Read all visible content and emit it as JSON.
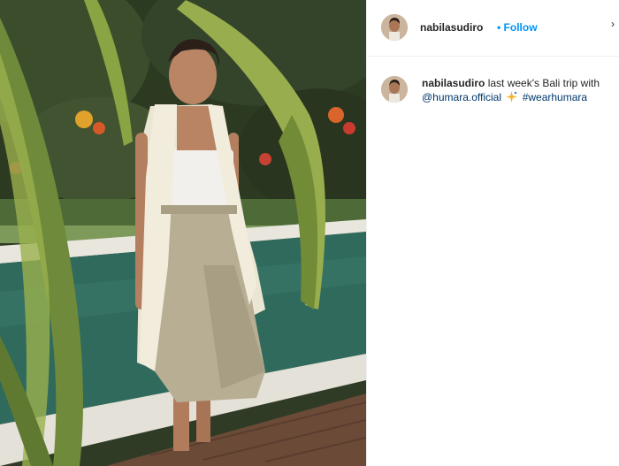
{
  "post": {
    "username": "nabilasudiro",
    "separator": "•",
    "follow_label": "Follow",
    "more_icon": "chevron-icon",
    "caption": {
      "username": "nabilasudiro",
      "text": "last week's Bali trip with",
      "mention": "@humara.official",
      "emoji": "sparkle-emoji",
      "hashtag": "#wearhumara"
    }
  },
  "colors": {
    "link_blue": "#0095f6",
    "text": "#262626",
    "mention": "#00376b"
  }
}
